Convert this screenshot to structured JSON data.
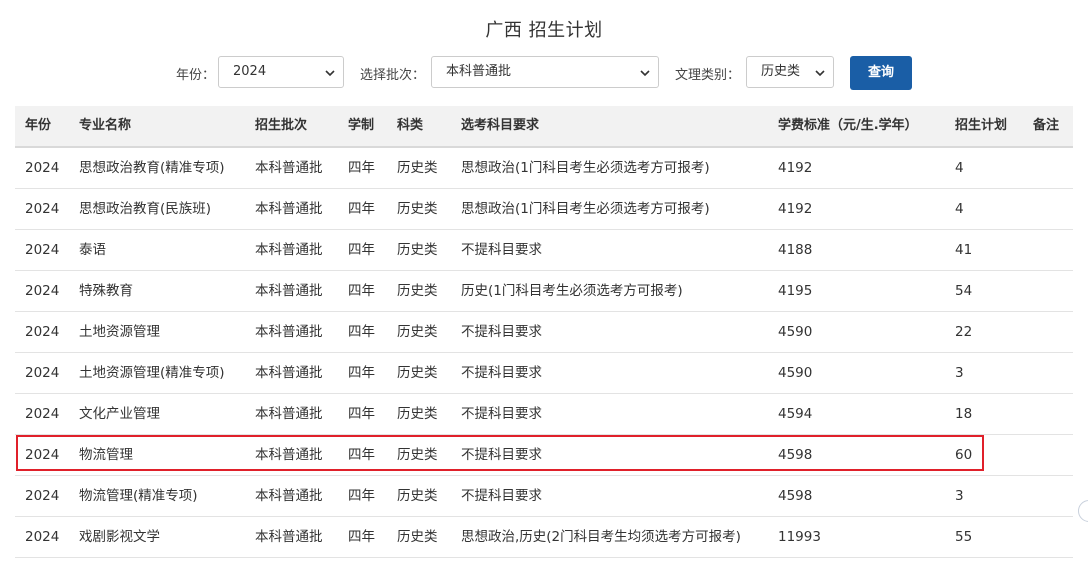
{
  "page": {
    "title": "广西 招生计划"
  },
  "filters": {
    "year_label": "年份：",
    "year_value": "2024",
    "batch_label": "选择批次：",
    "batch_value": "本科普通批",
    "category_label": "文理类别：",
    "category_value": "历史类",
    "query_button": "查询"
  },
  "table": {
    "headers": {
      "year": "年份",
      "major": "专业名称",
      "batch": "招生批次",
      "duration": "学制",
      "category": "科类",
      "requirement": "选考科目要求",
      "fee": "学费标准（元/生.学年）",
      "plan": "招生计划",
      "note": "备注"
    },
    "rows": [
      {
        "year": "2024",
        "major": "思想政治教育(精准专项)",
        "batch": "本科普通批",
        "duration": "四年",
        "category": "历史类",
        "requirement": "思想政治(1门科目考生必须选考方可报考)",
        "fee": "4192",
        "plan": "4",
        "note": ""
      },
      {
        "year": "2024",
        "major": "思想政治教育(民族班)",
        "batch": "本科普通批",
        "duration": "四年",
        "category": "历史类",
        "requirement": "思想政治(1门科目考生必须选考方可报考)",
        "fee": "4192",
        "plan": "4",
        "note": ""
      },
      {
        "year": "2024",
        "major": "泰语",
        "batch": "本科普通批",
        "duration": "四年",
        "category": "历史类",
        "requirement": "不提科目要求",
        "fee": "4188",
        "plan": "41",
        "note": ""
      },
      {
        "year": "2024",
        "major": "特殊教育",
        "batch": "本科普通批",
        "duration": "四年",
        "category": "历史类",
        "requirement": "历史(1门科目考生必须选考方可报考)",
        "fee": "4195",
        "plan": "54",
        "note": ""
      },
      {
        "year": "2024",
        "major": "土地资源管理",
        "batch": "本科普通批",
        "duration": "四年",
        "category": "历史类",
        "requirement": "不提科目要求",
        "fee": "4590",
        "plan": "22",
        "note": ""
      },
      {
        "year": "2024",
        "major": "土地资源管理(精准专项)",
        "batch": "本科普通批",
        "duration": "四年",
        "category": "历史类",
        "requirement": "不提科目要求",
        "fee": "4590",
        "plan": "3",
        "note": ""
      },
      {
        "year": "2024",
        "major": "文化产业管理",
        "batch": "本科普通批",
        "duration": "四年",
        "category": "历史类",
        "requirement": "不提科目要求",
        "fee": "4594",
        "plan": "18",
        "note": ""
      },
      {
        "year": "2024",
        "major": "物流管理",
        "batch": "本科普通批",
        "duration": "四年",
        "category": "历史类",
        "requirement": "不提科目要求",
        "fee": "4598",
        "plan": "60",
        "note": ""
      },
      {
        "year": "2024",
        "major": "物流管理(精准专项)",
        "batch": "本科普通批",
        "duration": "四年",
        "category": "历史类",
        "requirement": "不提科目要求",
        "fee": "4598",
        "plan": "3",
        "note": ""
      },
      {
        "year": "2024",
        "major": "戏剧影视文学",
        "batch": "本科普通批",
        "duration": "四年",
        "category": "历史类",
        "requirement": "思想政治,历史(2门科目考生均须选考方可报考)",
        "fee": "11993",
        "plan": "55",
        "note": ""
      }
    ]
  },
  "colors": {
    "accent": "#1a5ea6",
    "highlight": "#e0202a",
    "header_bg": "#f2f2f2"
  },
  "icons": {
    "select_arrow": "chevron-down-icon"
  }
}
